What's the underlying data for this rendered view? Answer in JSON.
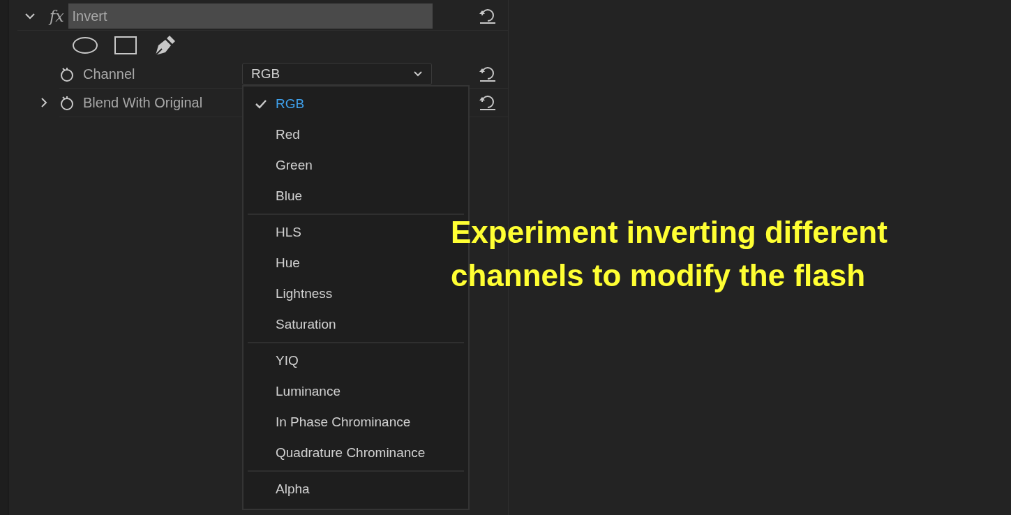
{
  "effect": {
    "fx_label": "fx",
    "name": "Invert",
    "expanded": true
  },
  "properties": [
    {
      "kind": "dropdown",
      "label": "Channel",
      "value": "RGB",
      "open": true
    },
    {
      "kind": "slider",
      "label": "Blend With Original",
      "expanded": false
    }
  ],
  "dropdown_menu": {
    "groups": [
      [
        {
          "label": "RGB",
          "selected": true
        },
        {
          "label": "Red",
          "selected": false
        },
        {
          "label": "Green",
          "selected": false
        },
        {
          "label": "Blue",
          "selected": false
        }
      ],
      [
        {
          "label": "HLS",
          "selected": false
        },
        {
          "label": "Hue",
          "selected": false
        },
        {
          "label": "Lightness",
          "selected": false
        },
        {
          "label": "Saturation",
          "selected": false
        }
      ],
      [
        {
          "label": "YIQ",
          "selected": false
        },
        {
          "label": "Luminance",
          "selected": false
        },
        {
          "label": "In Phase Chrominance",
          "selected": false
        },
        {
          "label": "Quadrature Chrominance",
          "selected": false
        }
      ],
      [
        {
          "label": "Alpha",
          "selected": false
        }
      ]
    ]
  },
  "annotation": "Experiment inverting different channels to modify the flash"
}
